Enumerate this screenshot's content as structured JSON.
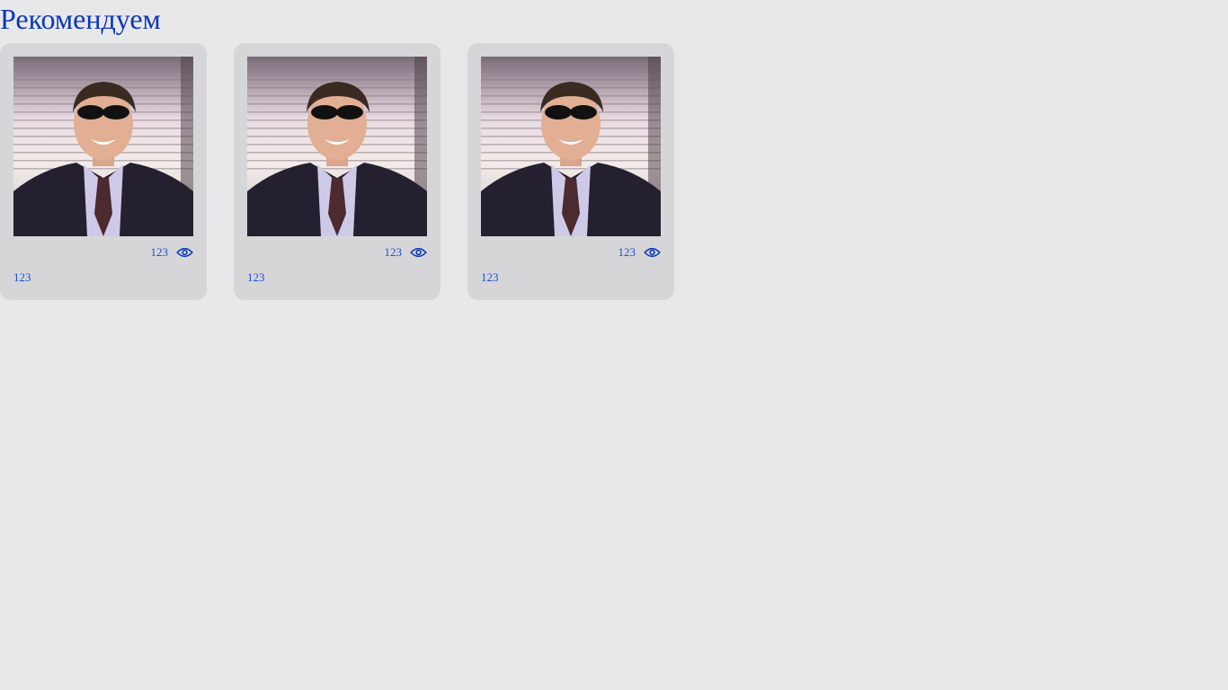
{
  "section": {
    "title": "Рекомендуем"
  },
  "cards": [
    {
      "views": "123",
      "caption": "123",
      "photo_icon": "person-photo"
    },
    {
      "views": "123",
      "caption": "123",
      "photo_icon": "person-photo"
    },
    {
      "views": "123",
      "caption": "123",
      "photo_icon": "person-photo"
    }
  ],
  "colors": {
    "background": "#e8e8eb",
    "card": "#d6d6d9",
    "accent": "#0b37b8",
    "link": "#1d4fd0"
  }
}
